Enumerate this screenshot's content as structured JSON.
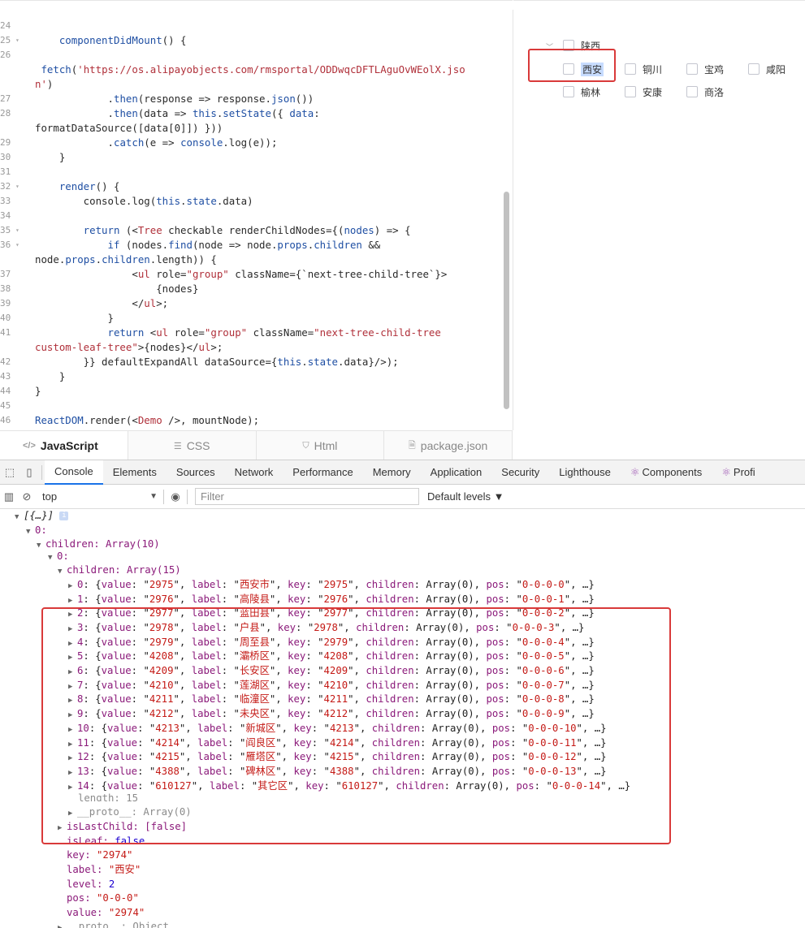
{
  "editor": {
    "lines": [
      {
        "num": "24",
        "fold": "",
        "parts": []
      },
      {
        "num": "25",
        "fold": "▾",
        "parts": [
          {
            "c": "fn",
            "t": "    componentDidMount"
          },
          {
            "c": "plain",
            "t": "() {"
          }
        ]
      },
      {
        "num": "26",
        "fold": "",
        "parts": []
      },
      {
        "num": "",
        "fold": "",
        "parts": [
          {
            "c": "plain",
            "t": " "
          },
          {
            "c": "fn",
            "t": "fetch"
          },
          {
            "c": "plain",
            "t": "("
          },
          {
            "c": "str",
            "t": "'https://os.alipayobjects.com/rmsportal/ODDwqcDFTLAguOvWEolX.jso"
          }
        ]
      },
      {
        "num": "",
        "fold": "",
        "parts": [
          {
            "c": "str",
            "t": "n'"
          },
          {
            "c": "plain",
            "t": ")"
          }
        ]
      },
      {
        "num": "27",
        "fold": "",
        "parts": [
          {
            "c": "plain",
            "t": "            ."
          },
          {
            "c": "fn",
            "t": "then"
          },
          {
            "c": "plain",
            "t": "(response => response."
          },
          {
            "c": "fn",
            "t": "json"
          },
          {
            "c": "plain",
            "t": "())"
          }
        ]
      },
      {
        "num": "28",
        "fold": "",
        "parts": [
          {
            "c": "plain",
            "t": "            ."
          },
          {
            "c": "fn",
            "t": "then"
          },
          {
            "c": "plain",
            "t": "(data => "
          },
          {
            "c": "kw",
            "t": "this"
          },
          {
            "c": "plain",
            "t": "."
          },
          {
            "c": "fn",
            "t": "setState"
          },
          {
            "c": "plain",
            "t": "({ "
          },
          {
            "c": "kw",
            "t": "data"
          },
          {
            "c": "plain",
            "t": ":"
          }
        ]
      },
      {
        "num": "",
        "fold": "",
        "parts": [
          {
            "c": "plain",
            "t": "formatDataSource([data[0]]) }))"
          }
        ]
      },
      {
        "num": "29",
        "fold": "",
        "parts": [
          {
            "c": "plain",
            "t": "            ."
          },
          {
            "c": "fn",
            "t": "catch"
          },
          {
            "c": "plain",
            "t": "(e => "
          },
          {
            "c": "fn",
            "t": "console"
          },
          {
            "c": "plain",
            "t": ".log(e));"
          }
        ]
      },
      {
        "num": "30",
        "fold": "",
        "parts": [
          {
            "c": "plain",
            "t": "    }"
          }
        ]
      },
      {
        "num": "31",
        "fold": "",
        "parts": []
      },
      {
        "num": "32",
        "fold": "▾",
        "parts": [
          {
            "c": "fn",
            "t": "    render"
          },
          {
            "c": "plain",
            "t": "() {"
          }
        ]
      },
      {
        "num": "33",
        "fold": "",
        "parts": [
          {
            "c": "plain",
            "t": "        console.log("
          },
          {
            "c": "kw",
            "t": "this"
          },
          {
            "c": "plain",
            "t": "."
          },
          {
            "c": "kw",
            "t": "state"
          },
          {
            "c": "plain",
            "t": ".data)"
          }
        ]
      },
      {
        "num": "34",
        "fold": "",
        "parts": []
      },
      {
        "num": "35",
        "fold": "▾",
        "parts": [
          {
            "c": "kw",
            "t": "        return"
          },
          {
            "c": "plain",
            "t": " (<"
          },
          {
            "c": "tag",
            "t": "Tree"
          },
          {
            "c": "plain",
            "t": " checkable renderChildNodes={("
          },
          {
            "c": "kw",
            "t": "nodes"
          },
          {
            "c": "plain",
            "t": ") => {"
          }
        ]
      },
      {
        "num": "36",
        "fold": "▾",
        "parts": [
          {
            "c": "kw",
            "t": "            if"
          },
          {
            "c": "plain",
            "t": " (nodes."
          },
          {
            "c": "fn",
            "t": "find"
          },
          {
            "c": "plain",
            "t": "(node => node."
          },
          {
            "c": "kw",
            "t": "props"
          },
          {
            "c": "plain",
            "t": "."
          },
          {
            "c": "kw",
            "t": "children"
          },
          {
            "c": "plain",
            "t": " &&"
          }
        ]
      },
      {
        "num": "",
        "fold": "",
        "parts": [
          {
            "c": "plain",
            "t": "node."
          },
          {
            "c": "kw",
            "t": "props"
          },
          {
            "c": "plain",
            "t": "."
          },
          {
            "c": "kw",
            "t": "children"
          },
          {
            "c": "plain",
            "t": ".length)) {"
          }
        ]
      },
      {
        "num": "37",
        "fold": "",
        "parts": [
          {
            "c": "plain",
            "t": "                <"
          },
          {
            "c": "tag",
            "t": "ul"
          },
          {
            "c": "plain",
            "t": " role="
          },
          {
            "c": "str",
            "t": "\"group\""
          },
          {
            "c": "plain",
            "t": " className={`next-tree-child-tree`}>"
          }
        ]
      },
      {
        "num": "38",
        "fold": "",
        "parts": [
          {
            "c": "plain",
            "t": "                    {nodes}"
          }
        ]
      },
      {
        "num": "39",
        "fold": "",
        "parts": [
          {
            "c": "plain",
            "t": "                </"
          },
          {
            "c": "tag",
            "t": "ul"
          },
          {
            "c": "plain",
            "t": ">;"
          }
        ]
      },
      {
        "num": "40",
        "fold": "",
        "parts": [
          {
            "c": "plain",
            "t": "            }"
          }
        ]
      },
      {
        "num": "41",
        "fold": "",
        "parts": [
          {
            "c": "kw",
            "t": "            return"
          },
          {
            "c": "plain",
            "t": " <"
          },
          {
            "c": "tag",
            "t": "ul"
          },
          {
            "c": "plain",
            "t": " role="
          },
          {
            "c": "str",
            "t": "\"group\""
          },
          {
            "c": "plain",
            "t": " className="
          },
          {
            "c": "str",
            "t": "\"next-tree-child-tree"
          }
        ]
      },
      {
        "num": "",
        "fold": "",
        "parts": [
          {
            "c": "str",
            "t": "custom-leaf-tree\""
          },
          {
            "c": "plain",
            "t": ">{nodes}</"
          },
          {
            "c": "tag",
            "t": "ul"
          },
          {
            "c": "plain",
            "t": ">;"
          }
        ]
      },
      {
        "num": "42",
        "fold": "",
        "parts": [
          {
            "c": "plain",
            "t": "        }} defaultExpandAll dataSource={"
          },
          {
            "c": "kw",
            "t": "this"
          },
          {
            "c": "plain",
            "t": "."
          },
          {
            "c": "kw",
            "t": "state"
          },
          {
            "c": "plain",
            "t": ".data}/>);"
          }
        ]
      },
      {
        "num": "43",
        "fold": "",
        "parts": [
          {
            "c": "plain",
            "t": "    }"
          }
        ]
      },
      {
        "num": "44",
        "fold": "",
        "parts": [
          {
            "c": "plain",
            "t": "}"
          }
        ]
      },
      {
        "num": "45",
        "fold": "",
        "parts": []
      },
      {
        "num": "46",
        "fold": "",
        "parts": [
          {
            "c": "fn",
            "t": "ReactDOM"
          },
          {
            "c": "plain",
            "t": ".render(<"
          },
          {
            "c": "tag",
            "t": "Demo"
          },
          {
            "c": "plain",
            "t": " />, mountNode);"
          }
        ]
      }
    ],
    "tabs": [
      {
        "label": "JavaScript",
        "icon": "</>"
      },
      {
        "label": "CSS",
        "icon": "☰"
      },
      {
        "label": "Html",
        "icon": "⛉"
      },
      {
        "label": "package.json",
        "icon": "🗎"
      }
    ]
  },
  "preview": {
    "root": "陕西",
    "row1": [
      "西安",
      "铜川",
      "宝鸡",
      "咸阳"
    ],
    "row2": [
      "榆林",
      "安康",
      "商洛"
    ]
  },
  "devtools": {
    "tabs": [
      "Console",
      "Elements",
      "Sources",
      "Network",
      "Performance",
      "Memory",
      "Application",
      "Security",
      "Lighthouse",
      "Components",
      "Profi"
    ],
    "context": "top",
    "filter_placeholder": "Filter",
    "levels": "Default levels ▼",
    "console": {
      "root_summary": "[{…}]",
      "idx0": "0:",
      "children_outer": "children: Array(10)",
      "idx0b": "0:",
      "children_inner": "children: Array(15)",
      "entries": [
        {
          "i": "0",
          "value": "2975",
          "label": "西安市",
          "key": "2975",
          "pos": "0-0-0-0"
        },
        {
          "i": "1",
          "value": "2976",
          "label": "高陵县",
          "key": "2976",
          "pos": "0-0-0-1"
        },
        {
          "i": "2",
          "value": "2977",
          "label": "蓝田县",
          "key": "2977",
          "pos": "0-0-0-2"
        },
        {
          "i": "3",
          "value": "2978",
          "label": "户县",
          "key": "2978",
          "pos": "0-0-0-3"
        },
        {
          "i": "4",
          "value": "2979",
          "label": "周至县",
          "key": "2979",
          "pos": "0-0-0-4"
        },
        {
          "i": "5",
          "value": "4208",
          "label": "灞桥区",
          "key": "4208",
          "pos": "0-0-0-5"
        },
        {
          "i": "6",
          "value": "4209",
          "label": "长安区",
          "key": "4209",
          "pos": "0-0-0-6"
        },
        {
          "i": "7",
          "value": "4210",
          "label": "莲湖区",
          "key": "4210",
          "pos": "0-0-0-7"
        },
        {
          "i": "8",
          "value": "4211",
          "label": "临潼区",
          "key": "4211",
          "pos": "0-0-0-8"
        },
        {
          "i": "9",
          "value": "4212",
          "label": "未央区",
          "key": "4212",
          "pos": "0-0-0-9"
        },
        {
          "i": "10",
          "value": "4213",
          "label": "新城区",
          "key": "4213",
          "pos": "0-0-0-10"
        },
        {
          "i": "11",
          "value": "4214",
          "label": "阎良区",
          "key": "4214",
          "pos": "0-0-0-11"
        },
        {
          "i": "12",
          "value": "4215",
          "label": "雁塔区",
          "key": "4215",
          "pos": "0-0-0-12"
        },
        {
          "i": "13",
          "value": "4388",
          "label": "碑林区",
          "key": "4388",
          "pos": "0-0-0-13"
        },
        {
          "i": "14",
          "value": "610127",
          "label": "其它区",
          "key": "610127",
          "pos": "0-0-0-14"
        }
      ],
      "length_line": "length: 15",
      "proto_array": "__proto__: Array(0)",
      "isLastChild": "isLastChild: [false]",
      "isLeaf_key": "isLeaf:",
      "isLeaf_val": "false",
      "key_key": "key:",
      "key_val": "\"2974\"",
      "label_key": "label:",
      "label_val": "\"西安\"",
      "level_key": "level:",
      "level_val": "2",
      "pos_key": "pos:",
      "pos_val": "\"0-0-0\"",
      "value_key": "value:",
      "value_val": "\"2974\"",
      "proto_obj": "__proto__: Object"
    }
  },
  "colors": {
    "highlight": "#d93a3a",
    "selection": "#c7dcff",
    "active_tab_underline": "#1a73e8"
  }
}
